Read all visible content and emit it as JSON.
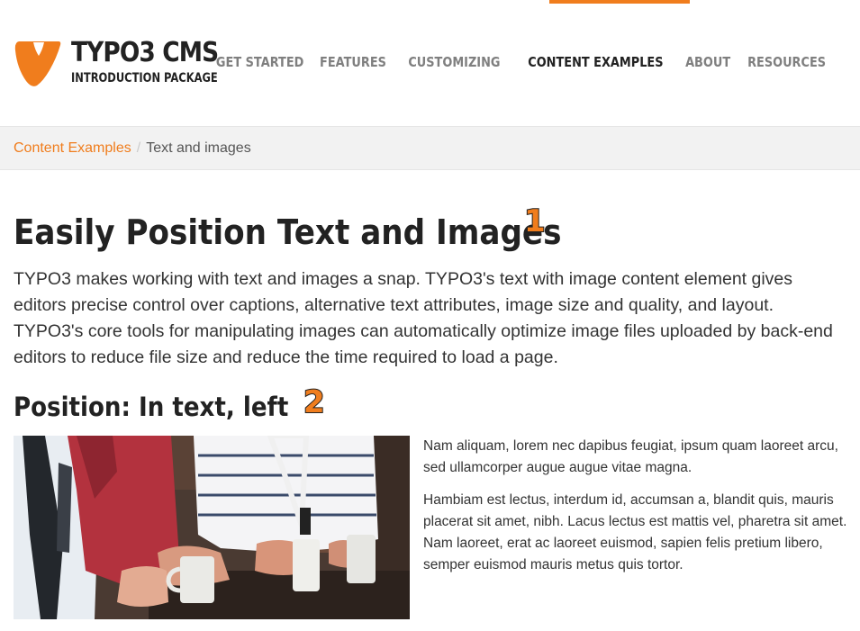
{
  "header": {
    "logo_title": "TYPO3 CMS",
    "logo_subtitle": "INTRODUCTION PACKAGE",
    "brand_color": "#f07d1d",
    "nav": [
      {
        "label": "GET STARTED",
        "active": false
      },
      {
        "label": "FEATURES",
        "active": false
      },
      {
        "label": "CUSTOMIZING",
        "active": false
      },
      {
        "label": "CONTENT EXAMPLES",
        "active": true
      },
      {
        "label": "ABOUT",
        "active": false
      },
      {
        "label": "RESOURCES",
        "active": false
      }
    ]
  },
  "breadcrumb": {
    "link": "Content Examples",
    "separator": "/",
    "current": "Text and images"
  },
  "main": {
    "title": "Easily Position Text and Images",
    "title_marker": "1",
    "intro": "TYPO3 makes working with text and images a snap. TYPO3's text with image content element gives editors precise control over captions, alternative text attributes, image size and quality, and layout. TYPO3's core tools for manipulating images can automatically optimize image files uploaded by back-end editors to reduce file size and reduce the time required to load a page.",
    "section_title": "Position: In text, left",
    "section_marker": "2",
    "paragraphs": [
      "Nam aliquam, lorem nec dapibus feugiat, ipsum quam laoreet arcu, sed ullamcorper augue augue vitae magna.",
      "Hambiam est lectus, interdum id, accumsan a, blandit quis, mauris placerat sit amet, nibh. Lacus lectus est mattis vel, pharetra sit amet. Nam laoreet, erat ac laoreet euismod, sapien felis pretium libero, semper euismod mauris metus quis tortor."
    ]
  }
}
